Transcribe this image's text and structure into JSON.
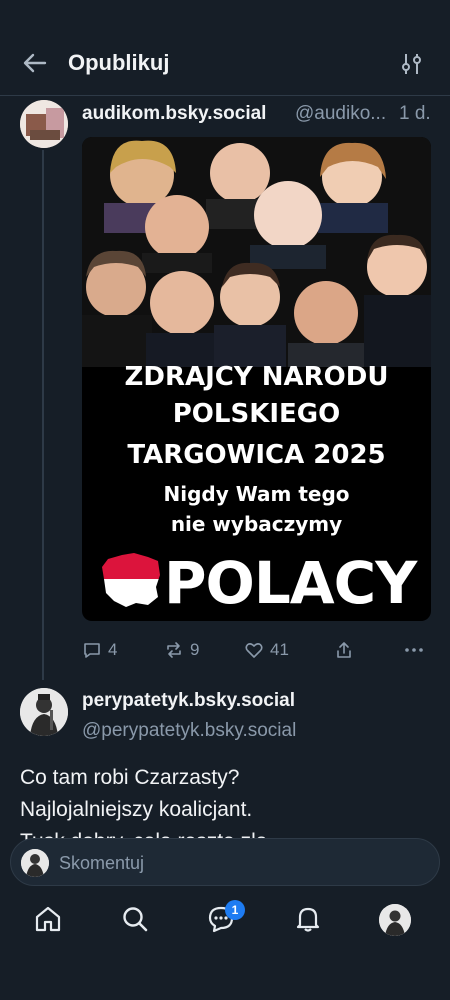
{
  "header": {
    "title": "Opublikuj",
    "back_icon": "arrow-left-icon",
    "filter_icon": "sliders-icon"
  },
  "post1": {
    "display_name": "audikom.bsky.social",
    "handle": "@audiko...",
    "time": "1 d.",
    "image_text": {
      "line1": "ZDRAJCY NARODU",
      "line2": "POLSKIEGO",
      "line3": "TARGOWICA 2025",
      "line4": "Nigdy Wam tego",
      "line5": "nie wybaczymy",
      "brand": "POLACY"
    },
    "actions": {
      "replies": "4",
      "reposts": "9",
      "likes": "41"
    }
  },
  "post2": {
    "display_name": "perypatetyk.bsky.social",
    "handle": "@perypatetyk.bsky.social",
    "text_lines": [
      "Co tam robi Czarzasty?",
      "Najlojalniejszy koalicjant.",
      "Tusk dobry, cała reszta zła"
    ]
  },
  "composer": {
    "placeholder": "Skomentuj"
  },
  "nav": {
    "chat_badge": "1"
  },
  "colors": {
    "background": "#161e27",
    "accent": "#1e7cf2",
    "muted": "#8a99aa",
    "poland_red": "#dc143c"
  }
}
